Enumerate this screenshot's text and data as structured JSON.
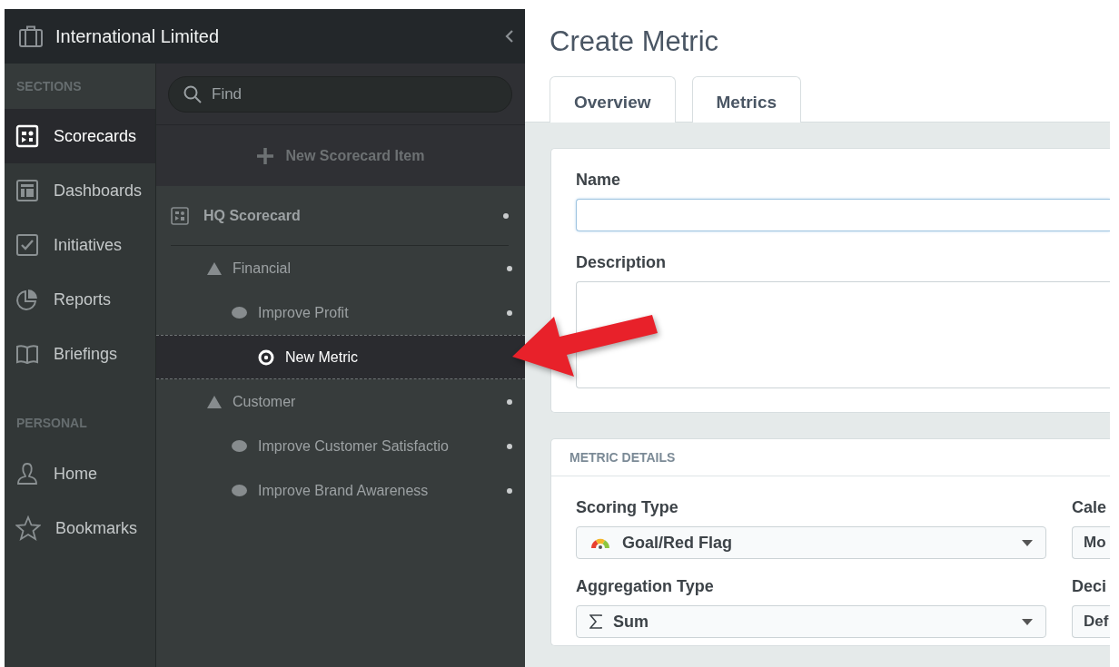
{
  "app": {
    "org_name": "International Limited"
  },
  "sidebar": {
    "sections": [
      {
        "heading": "SECTIONS",
        "items": [
          {
            "label": "Scorecards",
            "kind": "scorecard",
            "selected": true
          },
          {
            "label": "Dashboards",
            "kind": "dashboard",
            "selected": false
          },
          {
            "label": "Initiatives",
            "kind": "check",
            "selected": false
          },
          {
            "label": "Reports",
            "kind": "pie",
            "selected": false
          },
          {
            "label": "Briefings",
            "kind": "book",
            "selected": false
          }
        ]
      },
      {
        "heading": "PERSONAL",
        "items": [
          {
            "label": "Home",
            "kind": "person",
            "selected": false
          },
          {
            "label": "Bookmarks",
            "kind": "star",
            "selected": false
          }
        ]
      }
    ]
  },
  "tree_panel": {
    "search": {
      "placeholder": "Find"
    },
    "new_item_label": "New Scorecard Item",
    "items": [
      {
        "kind": "scorecard",
        "label": "HQ Scorecard",
        "selected": false,
        "children": [
          {
            "kind": "perspective",
            "label": "Financial",
            "selected": false,
            "children": [
              {
                "kind": "objective",
                "label": "Improve Profit",
                "selected": false,
                "children": [
                  {
                    "kind": "metric",
                    "label": "New Metric",
                    "selected": true
                  }
                ]
              }
            ]
          },
          {
            "kind": "perspective",
            "label": "Customer",
            "selected": false,
            "children": [
              {
                "kind": "objective",
                "label": "Improve Customer Satisfactio",
                "selected": false
              },
              {
                "kind": "objective",
                "label": "Improve Brand Awareness",
                "selected": false
              }
            ]
          }
        ]
      }
    ]
  },
  "main": {
    "title": "Create Metric",
    "tabs": [
      {
        "label": "Overview"
      },
      {
        "label": "Metrics"
      }
    ],
    "form": {
      "name_label": "Name",
      "name_focused": true,
      "description_label": "Description"
    },
    "details": {
      "heading": "METRIC DETAILS",
      "fields": [
        {
          "label": "Scoring Type",
          "value": "Goal/Red Flag",
          "kind": "gauge"
        },
        {
          "label": "Cale",
          "value": "Mo"
        },
        {
          "label": "Aggregation Type",
          "value": "Sum",
          "kind": "sigma"
        },
        {
          "label": "Deci",
          "value": "Def"
        }
      ]
    }
  }
}
